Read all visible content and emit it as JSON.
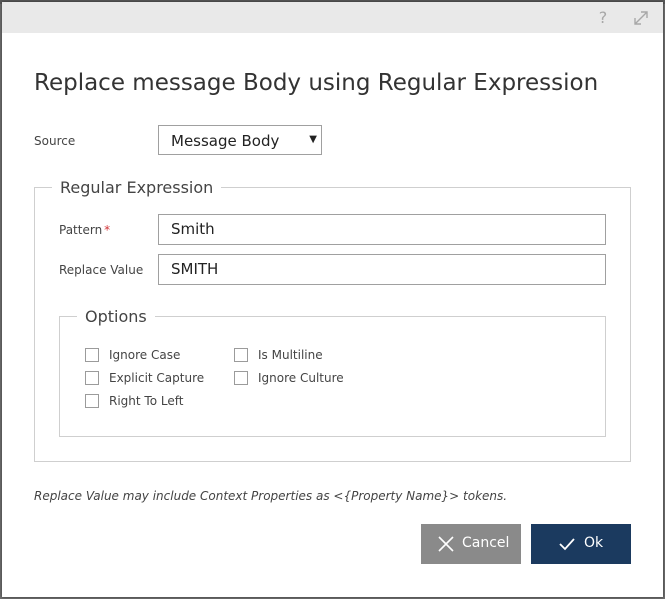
{
  "dialog": {
    "help_label": "?",
    "heading": "Replace message Body using Regular Expression"
  },
  "source": {
    "label": "Source",
    "selected": "Message Body",
    "arrow": "▼"
  },
  "regex": {
    "legend": "Regular Expression",
    "pattern_label": "Pattern",
    "required_mark": "*",
    "pattern_value": "Smith",
    "replace_label": "Replace Value",
    "replace_value": "SMITH"
  },
  "options": {
    "legend": "Options",
    "items": [
      {
        "label": "Ignore Case",
        "checked": false
      },
      {
        "label": "Explicit Capture",
        "checked": false
      },
      {
        "label": "Right To Left",
        "checked": false
      },
      {
        "label": "Is Multiline",
        "checked": false
      },
      {
        "label": "Ignore Culture",
        "checked": false
      }
    ]
  },
  "note": "Replace Value may include Context Properties as <{Property Name}> tokens.",
  "buttons": {
    "cancel_label": "Cancel",
    "ok_label": "Ok"
  },
  "colors": {
    "ok_button": "#1b3a5f",
    "cancel_button": "#8a8a8a",
    "required": "#d13438"
  }
}
